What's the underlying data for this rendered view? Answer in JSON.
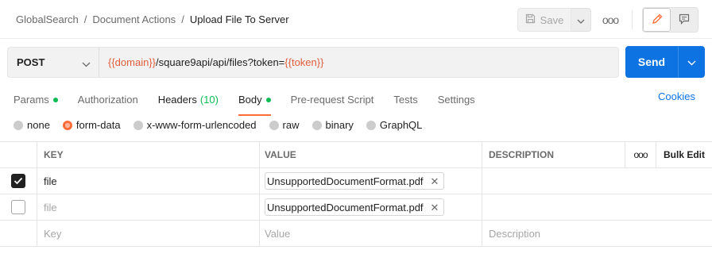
{
  "breadcrumb": {
    "items": [
      "GlobalSearch",
      "Document Actions"
    ],
    "current": "Upload File To Server",
    "separator": "/"
  },
  "toolbar": {
    "save_label": "Save",
    "more_label": "ooo"
  },
  "request": {
    "method": "POST",
    "url_parts": [
      {
        "text": "{{domain}}",
        "type": "var"
      },
      {
        "text": "/square9api/api/files?token=",
        "type": "text"
      },
      {
        "text": "{{token}}",
        "type": "var"
      }
    ],
    "send_label": "Send"
  },
  "tabs": [
    {
      "label": "Params",
      "dot": true
    },
    {
      "label": "Authorization"
    },
    {
      "label": "Headers",
      "count": "(10)"
    },
    {
      "label": "Body",
      "dot": true,
      "active": true
    },
    {
      "label": "Pre-request Script"
    },
    {
      "label": "Tests"
    },
    {
      "label": "Settings"
    }
  ],
  "cookies_label": "Cookies",
  "body_types": [
    {
      "label": "none"
    },
    {
      "label": "form-data",
      "selected": true
    },
    {
      "label": "x-www-form-urlencoded"
    },
    {
      "label": "raw"
    },
    {
      "label": "binary"
    },
    {
      "label": "GraphQL"
    }
  ],
  "table": {
    "headers": {
      "key": "KEY",
      "value": "VALUE",
      "description": "DESCRIPTION",
      "more": "ooo",
      "bulk_edit": "Bulk Edit"
    },
    "rows": [
      {
        "checked": true,
        "key": "file",
        "value": "UnsupportedDocumentFormat.pdf"
      },
      {
        "checked": false,
        "key": "file",
        "value": "UnsupportedDocumentFormat.pdf"
      }
    ],
    "placeholders": {
      "key": "Key",
      "value": "Value",
      "description": "Description"
    }
  },
  "colors": {
    "accent": "#ff6c37",
    "primary": "#0d73e2",
    "variable": "#e05f3c",
    "success": "#0cbb52"
  }
}
